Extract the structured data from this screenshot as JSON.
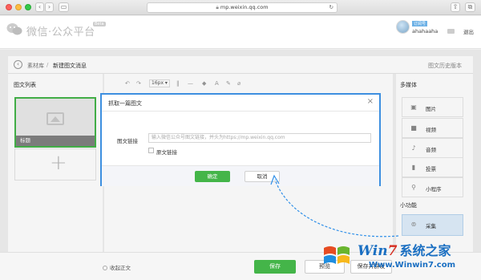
{
  "browser": {
    "url": "mp.weixin.qq.com"
  },
  "header": {
    "logo_text": "微信·公众平台",
    "beta_badge": "Beta",
    "account_badge": "订阅号",
    "account_name": "ahahaaha",
    "logout": "退出"
  },
  "breadcrumb": {
    "parent": "素材库",
    "separator": "/",
    "current": "新建图文消息",
    "history": "图文历史版本"
  },
  "article_list": {
    "title": "图文列表",
    "card_caption": "标题",
    "add_symbol": "+"
  },
  "toolbar": {
    "font_size": "16px",
    "items": [
      "↶",
      "↷",
      "‖",
      "—",
      "◆",
      "A",
      "✎",
      "⌀"
    ]
  },
  "media_panel": {
    "title": "多媒体",
    "items": [
      {
        "icon": "image-icon",
        "glyph": "▣",
        "label": "图片"
      },
      {
        "icon": "video-icon",
        "glyph": "■",
        "label": "视频"
      },
      {
        "icon": "audio-icon",
        "glyph": "♪",
        "label": "音频"
      },
      {
        "icon": "vote-icon",
        "glyph": "▮",
        "label": "投票"
      },
      {
        "icon": "miniprogram-icon",
        "glyph": "⚲",
        "label": "小程序"
      }
    ],
    "small_title": "小功能",
    "collect_label": "采集",
    "collect_glyph": "⊚"
  },
  "modal": {
    "title": "抓取一篇图文",
    "close": "×",
    "field_label": "图文链接",
    "field_placeholder": "输入微信公众号图文链接，并头为https://mp.weixin.qq.com",
    "checkbox_label": "原文链接",
    "ok_label": "确定",
    "cancel_label": "取消"
  },
  "bottom": {
    "collect_text": "收起正文",
    "save_label": "保存",
    "preview_label": "预览",
    "publish_label": "保存并群发"
  },
  "watermark": {
    "brand_win": "Win",
    "brand_seven": "7",
    "brand_cn": "系统之家",
    "url": "Www.Winwin7.com"
  },
  "colors": {
    "accent_green": "#44b549",
    "modal_border": "#3d8fe0",
    "active_item_bg": "#dfeefb"
  }
}
